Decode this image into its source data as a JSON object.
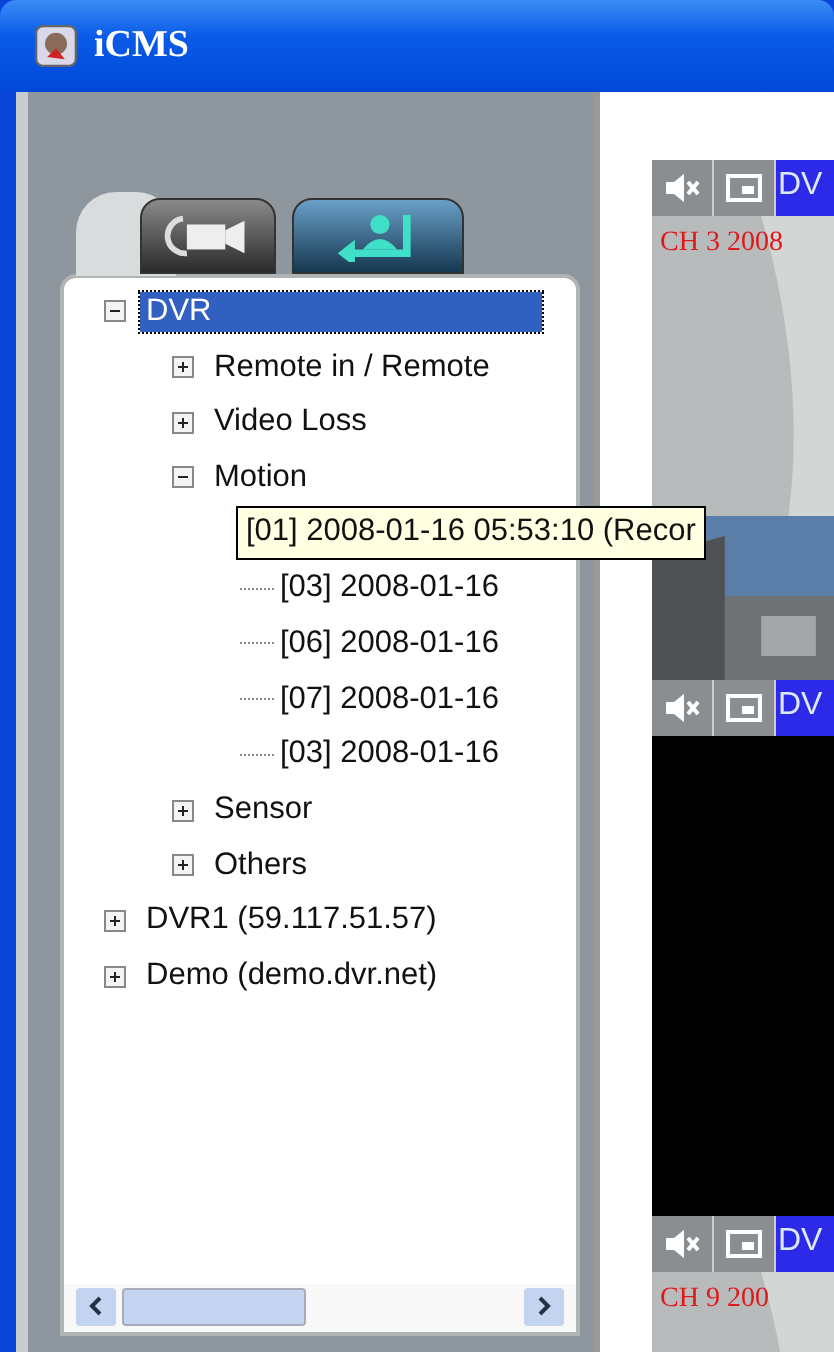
{
  "window": {
    "title": "iCMS"
  },
  "tabs": [
    {
      "kind": "camera",
      "selected": false
    },
    {
      "kind": "user",
      "selected": true
    }
  ],
  "tree": [
    {
      "label": "DVR",
      "expanded": true,
      "selected": true,
      "children": [
        {
          "label": "Remote in / Remote",
          "expanded": false,
          "selected": false
        },
        {
          "label": "Video Loss",
          "expanded": false,
          "selected": false
        },
        {
          "label": "Motion",
          "expanded": true,
          "selected": false,
          "children": [
            {
              "tooltip": "[01] 2008-01-16 05:53:10 (Recor"
            },
            {
              "label": "[03] 2008-01-16",
              "selected": false
            },
            {
              "label": "[06] 2008-01-16",
              "selected": false
            },
            {
              "label": "[07] 2008-01-16",
              "selected": false
            },
            {
              "label": "[03] 2008-01-16",
              "selected": false
            }
          ]
        },
        {
          "label": "Sensor",
          "expanded": false,
          "selected": false
        },
        {
          "label": "Others",
          "expanded": false,
          "selected": false
        }
      ]
    },
    {
      "label": "DVR1 (59.117.51.57)",
      "expanded": false,
      "selected": false
    },
    {
      "label": "Demo (demo.dvr.net)",
      "expanded": false,
      "selected": false
    }
  ],
  "videos": [
    {
      "label": "DV",
      "kind": "picture",
      "caption": "CH 3 2008"
    },
    {
      "label": "DV",
      "kind": "black"
    },
    {
      "label": "DV",
      "kind": "picture",
      "caption": "CH 9 200"
    }
  ]
}
